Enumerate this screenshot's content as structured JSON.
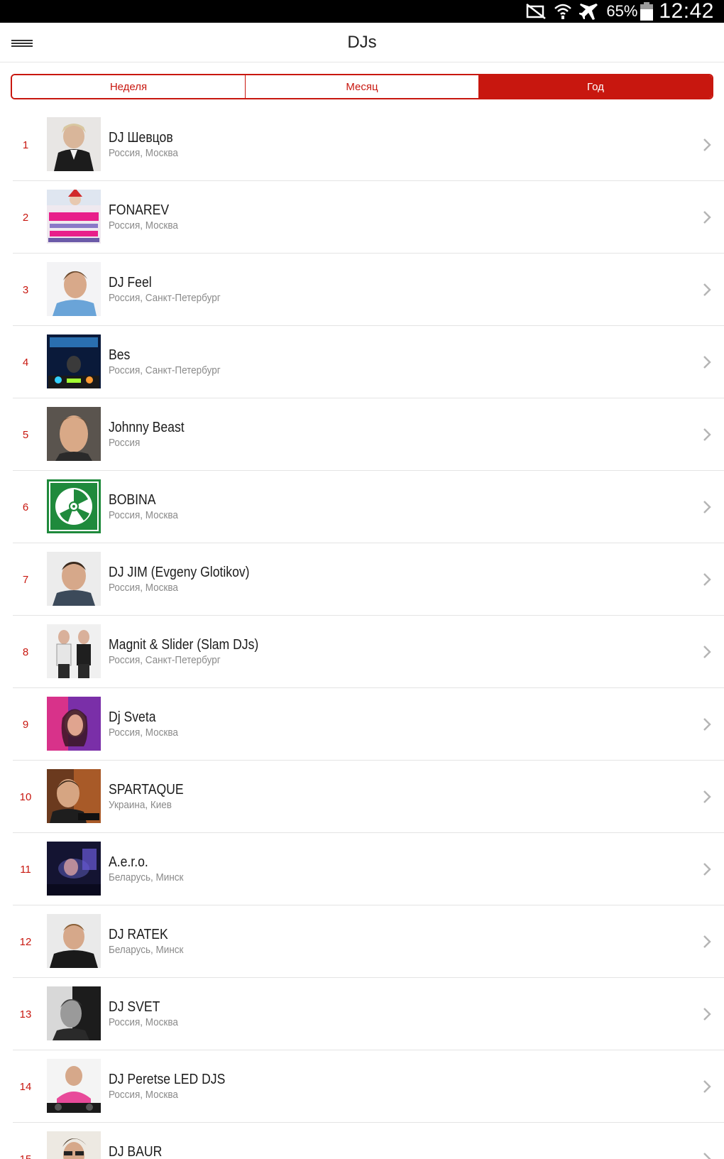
{
  "status_bar": {
    "battery_percent": "65%",
    "time": "12:42",
    "icons": [
      "mute-icon",
      "wifi-icon",
      "airplane-icon",
      "battery-icon"
    ]
  },
  "header": {
    "title": "DJs",
    "menu_icon": "hamburger-menu-icon"
  },
  "tabs": [
    {
      "label": "Неделя",
      "active": false
    },
    {
      "label": "Месяц",
      "active": false
    },
    {
      "label": "Год",
      "active": true
    }
  ],
  "colors": {
    "accent": "#c8170f",
    "text_primary": "#1c1c1c",
    "text_secondary": "#8a8a8a",
    "divider": "#e4e4e4"
  },
  "djs": [
    {
      "rank": "1",
      "name": "DJ Шевцов",
      "location": "Россия, Москва"
    },
    {
      "rank": "2",
      "name": "FONAREV",
      "location": "Россия, Москва"
    },
    {
      "rank": "3",
      "name": "DJ Feel",
      "location": "Россия, Санкт-Петербург"
    },
    {
      "rank": "4",
      "name": "Bes",
      "location": "Россия, Санкт-Петербург"
    },
    {
      "rank": "5",
      "name": "Johnny Beast",
      "location": "Россия"
    },
    {
      "rank": "6",
      "name": "BOBINA",
      "location": "Россия, Москва"
    },
    {
      "rank": "7",
      "name": "DJ JIM (Evgeny Glotikov)",
      "location": "Россия, Москва"
    },
    {
      "rank": "8",
      "name": "Magnit & Slider (Slam DJs)",
      "location": "Россия, Санкт-Петербург"
    },
    {
      "rank": "9",
      "name": "Dj Sveta",
      "location": "Россия, Москва"
    },
    {
      "rank": "10",
      "name": "SPARTAQUE",
      "location": "Украина, Киев"
    },
    {
      "rank": "11",
      "name": "A.e.r.o.",
      "location": "Беларусь, Минск"
    },
    {
      "rank": "12",
      "name": "DJ RATEK",
      "location": "Беларусь, Минск"
    },
    {
      "rank": "13",
      "name": "DJ SVET",
      "location": "Россия, Москва"
    },
    {
      "rank": "14",
      "name": "DJ Peretse LED DJS",
      "location": "Россия, Москва"
    },
    {
      "rank": "15",
      "name": "DJ BAUR",
      "location": ""
    }
  ]
}
